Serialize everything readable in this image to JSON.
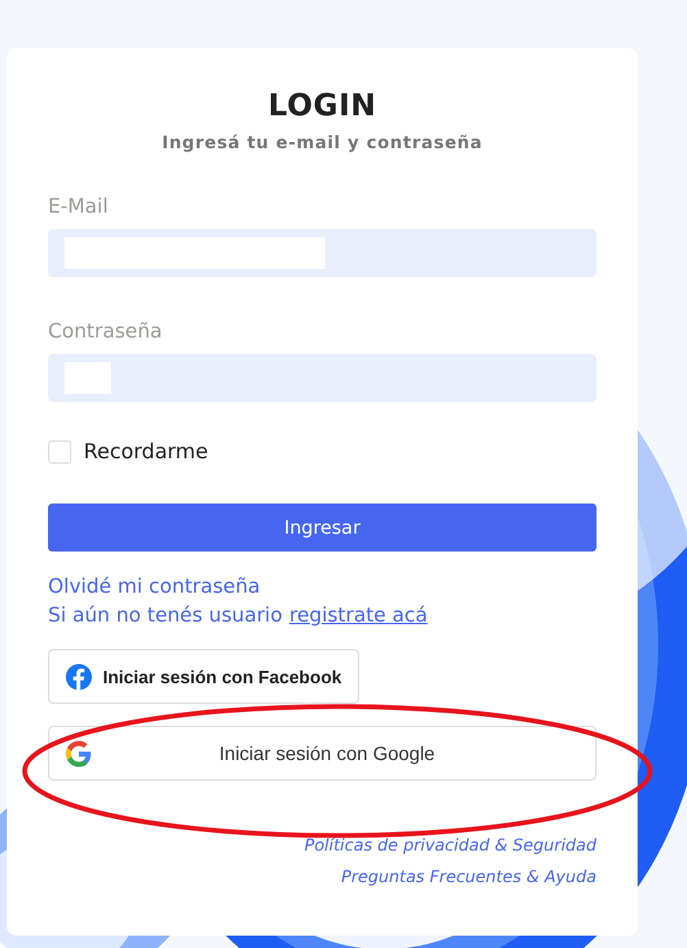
{
  "title": "LOGIN",
  "subtitle": "Ingresá tu e-mail y contraseña",
  "fields": [
    {
      "label": "E-Mail",
      "kind": "email",
      "redacted": true
    },
    {
      "label": "Contraseña",
      "kind": "password",
      "redacted": true
    }
  ],
  "remember": {
    "label": "Recordarme",
    "checked": false
  },
  "submit": "Ingresar",
  "forgot_link": "Olvidé mi contraseña",
  "register": {
    "text": "Si aún no tenés usuario",
    "link": "registrate acá"
  },
  "social_buttons": [
    {
      "kind": "facebook",
      "label": "Iniciar sesión con Facebook"
    },
    {
      "kind": "google",
      "label": "Iniciar sesión con Google"
    }
  ],
  "footer_links": [
    "Políticas de privacidad & Seguridad",
    "Preguntas Frecuentes & Ayuda"
  ],
  "annotation": {
    "kind": "ellipse"
  }
}
